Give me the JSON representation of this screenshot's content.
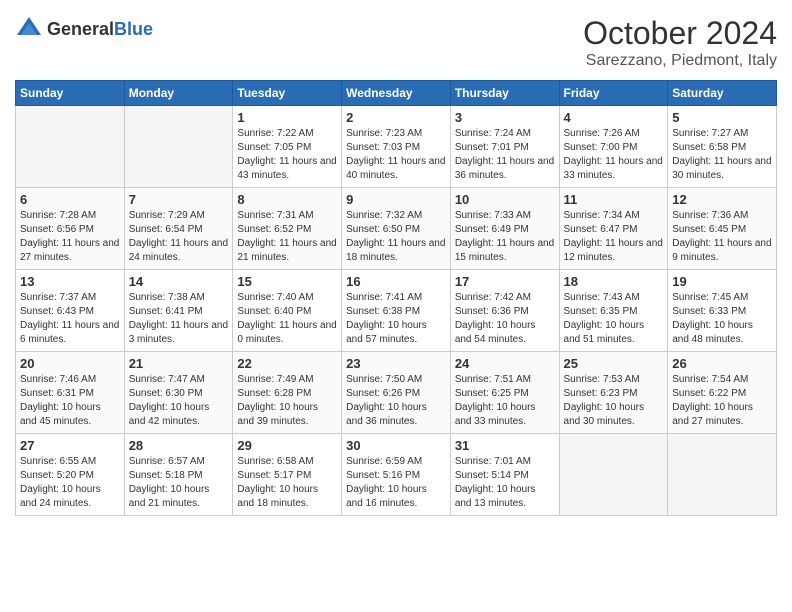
{
  "header": {
    "logo_general": "General",
    "logo_blue": "Blue",
    "month": "October 2024",
    "location": "Sarezzano, Piedmont, Italy"
  },
  "days_of_week": [
    "Sunday",
    "Monday",
    "Tuesday",
    "Wednesday",
    "Thursday",
    "Friday",
    "Saturday"
  ],
  "weeks": [
    [
      {
        "day": "",
        "info": ""
      },
      {
        "day": "",
        "info": ""
      },
      {
        "day": "1",
        "info": "Sunrise: 7:22 AM\nSunset: 7:05 PM\nDaylight: 11 hours and 43 minutes."
      },
      {
        "day": "2",
        "info": "Sunrise: 7:23 AM\nSunset: 7:03 PM\nDaylight: 11 hours and 40 minutes."
      },
      {
        "day": "3",
        "info": "Sunrise: 7:24 AM\nSunset: 7:01 PM\nDaylight: 11 hours and 36 minutes."
      },
      {
        "day": "4",
        "info": "Sunrise: 7:26 AM\nSunset: 7:00 PM\nDaylight: 11 hours and 33 minutes."
      },
      {
        "day": "5",
        "info": "Sunrise: 7:27 AM\nSunset: 6:58 PM\nDaylight: 11 hours and 30 minutes."
      }
    ],
    [
      {
        "day": "6",
        "info": "Sunrise: 7:28 AM\nSunset: 6:56 PM\nDaylight: 11 hours and 27 minutes."
      },
      {
        "day": "7",
        "info": "Sunrise: 7:29 AM\nSunset: 6:54 PM\nDaylight: 11 hours and 24 minutes."
      },
      {
        "day": "8",
        "info": "Sunrise: 7:31 AM\nSunset: 6:52 PM\nDaylight: 11 hours and 21 minutes."
      },
      {
        "day": "9",
        "info": "Sunrise: 7:32 AM\nSunset: 6:50 PM\nDaylight: 11 hours and 18 minutes."
      },
      {
        "day": "10",
        "info": "Sunrise: 7:33 AM\nSunset: 6:49 PM\nDaylight: 11 hours and 15 minutes."
      },
      {
        "day": "11",
        "info": "Sunrise: 7:34 AM\nSunset: 6:47 PM\nDaylight: 11 hours and 12 minutes."
      },
      {
        "day": "12",
        "info": "Sunrise: 7:36 AM\nSunset: 6:45 PM\nDaylight: 11 hours and 9 minutes."
      }
    ],
    [
      {
        "day": "13",
        "info": "Sunrise: 7:37 AM\nSunset: 6:43 PM\nDaylight: 11 hours and 6 minutes."
      },
      {
        "day": "14",
        "info": "Sunrise: 7:38 AM\nSunset: 6:41 PM\nDaylight: 11 hours and 3 minutes."
      },
      {
        "day": "15",
        "info": "Sunrise: 7:40 AM\nSunset: 6:40 PM\nDaylight: 11 hours and 0 minutes."
      },
      {
        "day": "16",
        "info": "Sunrise: 7:41 AM\nSunset: 6:38 PM\nDaylight: 10 hours and 57 minutes."
      },
      {
        "day": "17",
        "info": "Sunrise: 7:42 AM\nSunset: 6:36 PM\nDaylight: 10 hours and 54 minutes."
      },
      {
        "day": "18",
        "info": "Sunrise: 7:43 AM\nSunset: 6:35 PM\nDaylight: 10 hours and 51 minutes."
      },
      {
        "day": "19",
        "info": "Sunrise: 7:45 AM\nSunset: 6:33 PM\nDaylight: 10 hours and 48 minutes."
      }
    ],
    [
      {
        "day": "20",
        "info": "Sunrise: 7:46 AM\nSunset: 6:31 PM\nDaylight: 10 hours and 45 minutes."
      },
      {
        "day": "21",
        "info": "Sunrise: 7:47 AM\nSunset: 6:30 PM\nDaylight: 10 hours and 42 minutes."
      },
      {
        "day": "22",
        "info": "Sunrise: 7:49 AM\nSunset: 6:28 PM\nDaylight: 10 hours and 39 minutes."
      },
      {
        "day": "23",
        "info": "Sunrise: 7:50 AM\nSunset: 6:26 PM\nDaylight: 10 hours and 36 minutes."
      },
      {
        "day": "24",
        "info": "Sunrise: 7:51 AM\nSunset: 6:25 PM\nDaylight: 10 hours and 33 minutes."
      },
      {
        "day": "25",
        "info": "Sunrise: 7:53 AM\nSunset: 6:23 PM\nDaylight: 10 hours and 30 minutes."
      },
      {
        "day": "26",
        "info": "Sunrise: 7:54 AM\nSunset: 6:22 PM\nDaylight: 10 hours and 27 minutes."
      }
    ],
    [
      {
        "day": "27",
        "info": "Sunrise: 6:55 AM\nSunset: 5:20 PM\nDaylight: 10 hours and 24 minutes."
      },
      {
        "day": "28",
        "info": "Sunrise: 6:57 AM\nSunset: 5:18 PM\nDaylight: 10 hours and 21 minutes."
      },
      {
        "day": "29",
        "info": "Sunrise: 6:58 AM\nSunset: 5:17 PM\nDaylight: 10 hours and 18 minutes."
      },
      {
        "day": "30",
        "info": "Sunrise: 6:59 AM\nSunset: 5:16 PM\nDaylight: 10 hours and 16 minutes."
      },
      {
        "day": "31",
        "info": "Sunrise: 7:01 AM\nSunset: 5:14 PM\nDaylight: 10 hours and 13 minutes."
      },
      {
        "day": "",
        "info": ""
      },
      {
        "day": "",
        "info": ""
      }
    ]
  ]
}
